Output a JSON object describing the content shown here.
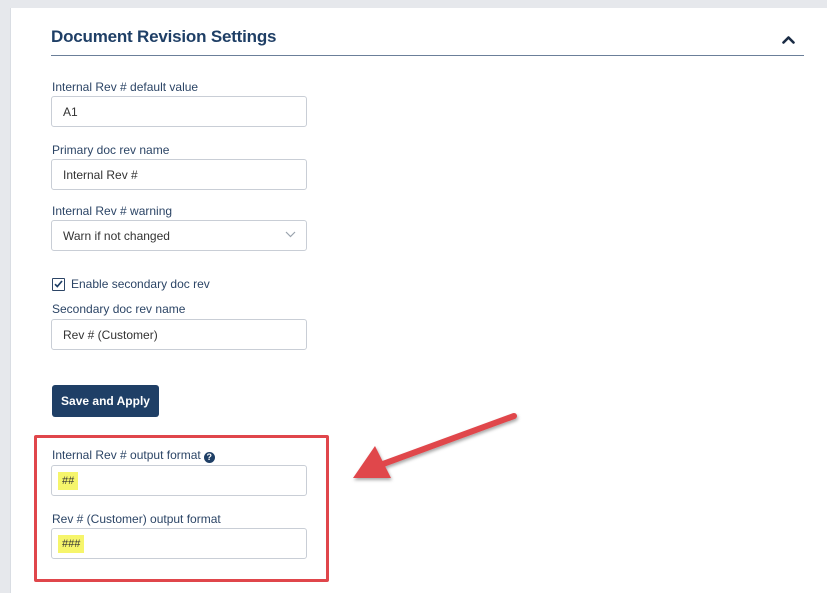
{
  "section": {
    "title": "Document Revision Settings"
  },
  "fields": {
    "internal_rev_default": {
      "label": "Internal Rev # default value",
      "value": "A1"
    },
    "primary_doc_rev_name": {
      "label": "Primary doc rev name",
      "value": "Internal Rev #"
    },
    "internal_rev_warning": {
      "label": "Internal Rev # warning",
      "selected": "Warn if not changed"
    },
    "enable_secondary": {
      "label": "Enable secondary doc rev",
      "checked": true
    },
    "secondary_doc_rev_name": {
      "label": "Secondary doc rev name",
      "value": "Rev # (Customer)"
    }
  },
  "buttons": {
    "save_label": "Save and Apply"
  },
  "output_formats": {
    "internal_label": "Internal Rev # output format",
    "internal_value": "##",
    "customer_label": "Rev # (Customer) output format",
    "customer_value": "###"
  },
  "colors": {
    "accent": "#1f3f66",
    "annotation": "#e0464b",
    "highlight": "#f6f56b"
  },
  "icons": {
    "collapse": "chevron-up-icon",
    "select": "chevron-down-icon",
    "checkbox": "checkmark-icon",
    "help": "question-circle-icon",
    "annotation": "red-arrow-icon"
  }
}
